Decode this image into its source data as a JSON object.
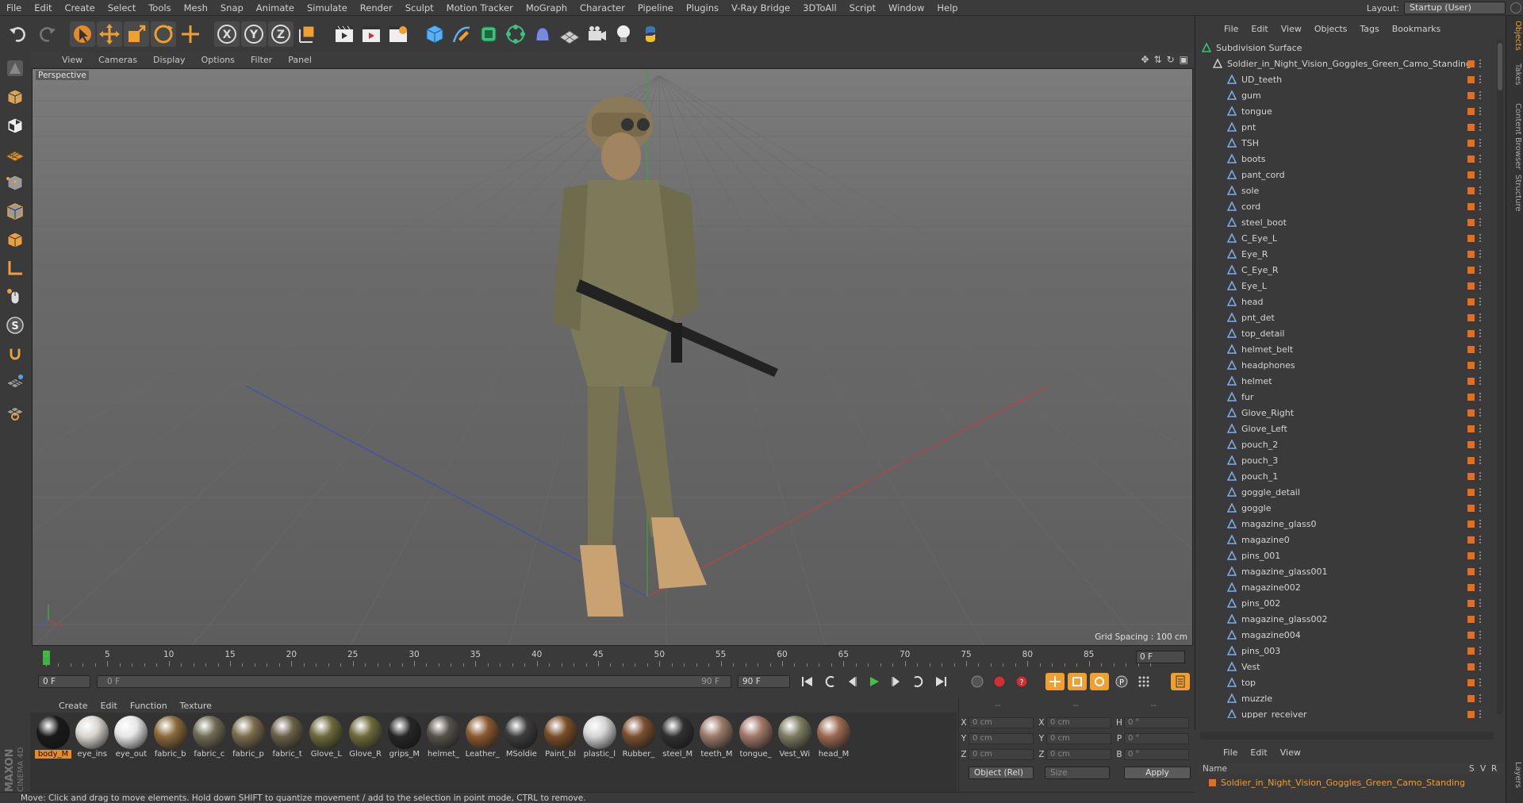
{
  "menu": [
    "File",
    "Edit",
    "Create",
    "Select",
    "Tools",
    "Mesh",
    "Snap",
    "Animate",
    "Simulate",
    "Render",
    "Sculpt",
    "Motion Tracker",
    "MoGraph",
    "Character",
    "Pipeline",
    "Plugins",
    "V-Ray Bridge",
    "3DToAll",
    "Script",
    "Window",
    "Help"
  ],
  "layout": {
    "label": "Layout:",
    "value": "Startup (User)"
  },
  "toolbar_icons": [
    "undo-icon",
    "redo-icon",
    "select-arrow-icon",
    "move-icon",
    "scale-icon",
    "rotate-icon",
    "last-tool-icon",
    "x-axis-icon",
    "y-axis-icon",
    "z-axis-icon",
    "world-coord-icon",
    "render-view-icon",
    "render-picture-viewer-icon",
    "render-settings-icon",
    "cube-icon",
    "pen-spline-icon",
    "nurbs-icon",
    "array-icon",
    "deformer-icon",
    "floor-icon",
    "camera-icon",
    "light-icon",
    "python-icon"
  ],
  "viewport": {
    "menu": [
      "View",
      "Cameras",
      "Display",
      "Options",
      "Filter",
      "Panel"
    ],
    "label": "Perspective",
    "grid_spacing": "Grid Spacing : 100 cm"
  },
  "timeline": {
    "ticks": [
      0,
      5,
      10,
      15,
      20,
      25,
      30,
      35,
      40,
      45,
      50,
      55,
      60,
      65,
      70,
      75,
      80,
      85,
      90
    ],
    "current_frame": "0 F"
  },
  "transport": {
    "start": "0 F",
    "range_start": "0 F",
    "range_end": "90 F",
    "end": "90 F"
  },
  "materials": {
    "menu": [
      "Create",
      "Edit",
      "Function",
      "Texture"
    ],
    "items": [
      {
        "name": "body_M",
        "color": "#1a1a1a",
        "selected": true
      },
      {
        "name": "eye_ins",
        "color": "#d9d6cf"
      },
      {
        "name": "eye_out",
        "color": "#e6e6e6"
      },
      {
        "name": "fabric_b",
        "color": "#8a6a3a"
      },
      {
        "name": "fabric_c",
        "color": "#6f6a55"
      },
      {
        "name": "fabric_p",
        "color": "#7a6c4c"
      },
      {
        "name": "fabric_t",
        "color": "#6a6048"
      },
      {
        "name": "Glove_L",
        "color": "#6d6a3c"
      },
      {
        "name": "Glove_R",
        "color": "#6d6a3c"
      },
      {
        "name": "grips_M",
        "color": "#262626"
      },
      {
        "name": "helmet_",
        "color": "#55524a"
      },
      {
        "name": "Leather_",
        "color": "#8a5a30"
      },
      {
        "name": "MSoldie",
        "color": "#3c3c3c"
      },
      {
        "name": "Paint_bl",
        "color": "#7a4e28"
      },
      {
        "name": "plastic_l",
        "color": "#d4d4d4"
      },
      {
        "name": "Rubber_",
        "color": "#7a5030"
      },
      {
        "name": "steel_M",
        "color": "#303030"
      },
      {
        "name": "teeth_M",
        "color": "#9a7a68"
      },
      {
        "name": "tongue_",
        "color": "#a07868"
      },
      {
        "name": "Vest_Wi",
        "color": "#7d7c62"
      },
      {
        "name": "head_M",
        "color": "#9a6a50"
      }
    ]
  },
  "coords": {
    "rows": [
      {
        "a": "X",
        "av": "0 cm",
        "b": "X",
        "bv": "0 cm",
        "c": "H",
        "cv": "0 °"
      },
      {
        "a": "Y",
        "av": "0 cm",
        "b": "Y",
        "bv": "0 cm",
        "c": "P",
        "cv": "0 °"
      },
      {
        "a": "Z",
        "av": "0 cm",
        "b": "Z",
        "bv": "0 cm",
        "c": "B",
        "cv": "0 °"
      }
    ],
    "headers": [
      "--",
      "--",
      "--"
    ],
    "mode": "Object (Rel)",
    "size": "Size",
    "apply": "Apply"
  },
  "status": "Move: Click and drag to move elements. Hold down SHIFT to quantize movement / add to the selection in point mode, CTRL to remove.",
  "object_manager": {
    "menu": [
      "File",
      "Edit",
      "View",
      "Objects",
      "Tags",
      "Bookmarks"
    ],
    "root": "Subdivision Surface",
    "group": "Soldier_in_Night_Vision_Goggles_Green_Camo_Standing",
    "children": [
      "UD_teeth",
      "gum",
      "tongue",
      "pnt",
      "TSH",
      "boots",
      "pant_cord",
      "sole",
      "cord",
      "steel_boot",
      "C_Eye_L",
      "Eye_R",
      "C_Eye_R",
      "Eye_L",
      "head",
      "pnt_det",
      "top_detail",
      "helmet_belt",
      "headphones",
      "helmet",
      "fur",
      "Glove_Right",
      "Glove_Left",
      "pouch_2",
      "pouch_3",
      "pouch_1",
      "goggle_detail",
      "goggle",
      "magazine_glass0",
      "magazine0",
      "pins_001",
      "magazine_glass001",
      "magazine002",
      "pins_002",
      "magazine_glass002",
      "magazine004",
      "pins_003",
      "Vest",
      "top",
      "muzzle",
      "upper_receiver"
    ]
  },
  "attributes": {
    "menu": [
      "File",
      "Edit",
      "View"
    ],
    "col_name": "Name",
    "col_s": "S",
    "col_v": "V",
    "col_r": "R",
    "item": "Soldier_in_Night_Vision_Goggles_Green_Camo_Standing"
  },
  "side_tabs": [
    "Objects",
    "Takes",
    "Content Browser",
    "Structure",
    "Layers"
  ]
}
